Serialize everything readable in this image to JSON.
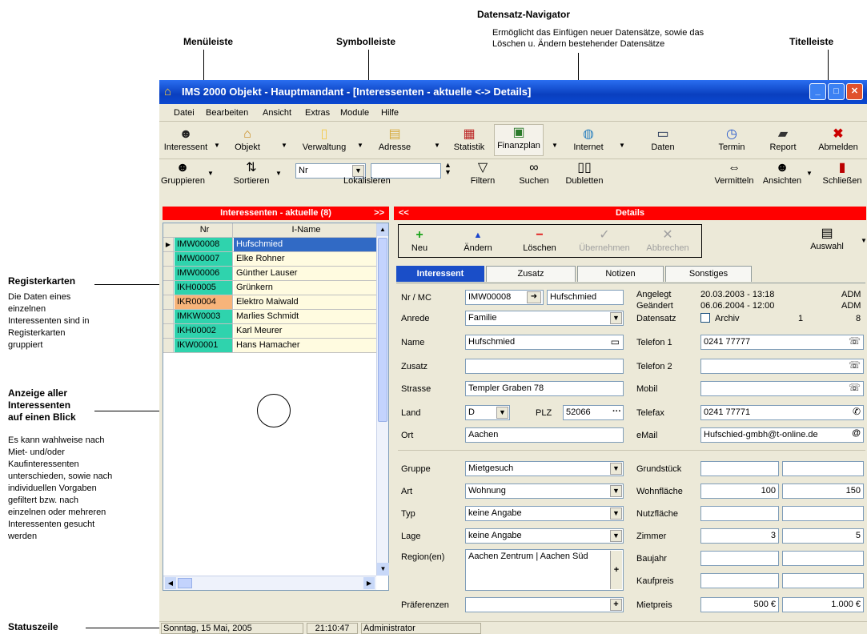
{
  "annotations": {
    "datensatz_title": "Datensatz-Navigator",
    "datensatz_desc1": "Ermöglicht das Einfügen neuer Datensätze, sowie das",
    "datensatz_desc2": "Löschen u. Ändern bestehender Datensätze",
    "menueleiste": "Menüleiste",
    "symbolleiste": "Symbolleiste",
    "titelleiste": "Titelleiste",
    "registerkarten_title": "Registerkarten",
    "registerkarten_desc": [
      "Die Daten eines",
      "einzelnen",
      "Interessenten sind in",
      "Registerkarten",
      "gruppiert"
    ],
    "anzeige_title": [
      "Anzeige aller",
      "Interessenten",
      "auf einen Blick"
    ],
    "anzeige_desc": [
      "Es kann wahlweise nach",
      "Miet- und/oder",
      "Kaufinteressenten",
      "unterschieden, sowie nach",
      "individuellen Vorgaben",
      "gefiltert bzw. nach",
      "einzelnen oder mehreren",
      "Interessenten gesucht",
      "werden"
    ],
    "statuszeile": "Statuszeile"
  },
  "window": {
    "title": "IMS 2000 Objekt - Hauptmandant - [Interessenten - aktuelle <-> Details]",
    "menu": [
      "Datei",
      "Bearbeiten",
      "Ansicht",
      "Extras",
      "Module",
      "Hilfe"
    ],
    "toolbar1": [
      {
        "label": "Interessent",
        "icon": "person-icon"
      },
      {
        "label": "Objekt",
        "icon": "house-icon"
      },
      {
        "label": "Verwaltung",
        "icon": "document-icon"
      },
      {
        "label": "Adresse",
        "icon": "folder-icon"
      },
      {
        "label": "Statistik",
        "icon": "chart-icon"
      },
      {
        "label": "Finanzplan",
        "icon": "finance-icon"
      },
      {
        "label": "Internet",
        "icon": "globe-icon"
      },
      {
        "label": "Daten",
        "icon": "computer-icon"
      },
      {
        "label": "Termin",
        "icon": "clock-icon"
      },
      {
        "label": "Report",
        "icon": "printer-icon"
      },
      {
        "label": "Abmelden",
        "icon": "close-x-icon"
      }
    ],
    "toolbar2": {
      "gruppieren": "Gruppieren",
      "sortieren": "Sortieren",
      "sort_field": "Nr",
      "lokalisieren": "Lokalisieren",
      "filtern": "Filtern",
      "suchen": "Suchen",
      "dubletten": "Dubletten",
      "vermitteln": "Vermitteln",
      "ansichten": "Ansichten",
      "schliessen": "Schließen"
    },
    "list_header": "Interessenten - aktuelle (8)",
    "list_header_arrow": ">>",
    "details_header": "Details",
    "details_header_arrow": "<<",
    "grid_cols": [
      "Nr",
      "I-Name"
    ],
    "grid_rows": [
      {
        "nr": "IMW00008",
        "name": "Hufschmied",
        "color": "#2fd3ad",
        "selected": true
      },
      {
        "nr": "IMW00007",
        "name": "Elke Rohner",
        "color": "#2fd3ad"
      },
      {
        "nr": "IMW00006",
        "name": "Günther Lauser",
        "color": "#2fd3ad"
      },
      {
        "nr": "IKH00005",
        "name": "Grünkern",
        "color": "#2fd3ad"
      },
      {
        "nr": "IKR00004",
        "name": "Elektro Maiwald",
        "color": "#f7b47a"
      },
      {
        "nr": "IMKW0003",
        "name": "Marlies Schmidt",
        "color": "#2fd3ad"
      },
      {
        "nr": "IKH00002",
        "name": "Karl Meurer",
        "color": "#2fd3ad"
      },
      {
        "nr": "IKW00001",
        "name": "Hans Hamacher",
        "color": "#2fd3ad"
      }
    ],
    "nav_buttons": [
      "Neu",
      "Ändern",
      "Löschen",
      "Übernehmen",
      "Abbrechen"
    ],
    "auswahl": "Auswahl",
    "tabs": [
      "Interessent",
      "Zusatz",
      "Notizen",
      "Sonstiges"
    ],
    "form": {
      "nr_mc_label": "Nr / MC",
      "nr": "IMW00008",
      "mc": "Hufschmied",
      "anrede_label": "Anrede",
      "anrede": "Familie",
      "name_label": "Name",
      "name": "Hufschmied",
      "zusatz_label": "Zusatz",
      "zusatz": "",
      "strasse_label": "Strasse",
      "strasse": "Templer Graben 78",
      "land_label": "Land",
      "land": "D",
      "plz_label": "PLZ",
      "plz": "52066",
      "ort_label": "Ort",
      "ort": "Aachen",
      "angelegt_label": "Angelegt",
      "angelegt": "20.03.2003 - 13:18",
      "angelegt_user": "ADM",
      "geaendert_label": "Geändert",
      "geaendert": "06.06.2004 - 12:00",
      "geaendert_user": "ADM",
      "datensatz_label": "Datensatz",
      "archiv_label": "Archiv",
      "datensatz_nr": "1",
      "datensatz_total": "8",
      "telefon1_label": "Telefon 1",
      "telefon1": "0241 77777",
      "telefon2_label": "Telefon 2",
      "telefon2": "",
      "mobil_label": "Mobil",
      "mobil": "",
      "telefax_label": "Telefax",
      "telefax": "0241 77771",
      "email_label": "eMail",
      "email": "Hufschied-gmbh@t-online.de",
      "gruppe_label": "Gruppe",
      "gruppe": "Mietgesuch",
      "art_label": "Art",
      "art": "Wohnung",
      "typ_label": "Typ",
      "typ": "keine Angabe",
      "lage_label": "Lage",
      "lage": "keine Angabe",
      "region_label": "Region(en)",
      "region": "Aachen Zentrum | Aachen Süd",
      "praeferenzen_label": "Präferenzen",
      "praeferenzen": "",
      "grundstueck_label": "Grundstück",
      "wohnflaeche_label": "Wohnfläche",
      "wohnflaeche_min": "100",
      "wohnflaeche_max": "150",
      "nutzflaeche_label": "Nutzfläche",
      "zimmer_label": "Zimmer",
      "zimmer_min": "3",
      "zimmer_max": "5",
      "baujahr_label": "Baujahr",
      "kaufpreis_label": "Kaufpreis",
      "mietpreis_label": "Mietpreis",
      "mietpreis_min": "500 €",
      "mietpreis_max": "1.000 €"
    },
    "status": {
      "date": "Sonntag, 15 Mai, 2005",
      "time": "21:10:47",
      "user": "Administrator"
    }
  },
  "colors": {
    "title_blue": "#0a3fbf",
    "header_red": "#ff0000",
    "selection": "#316ac5"
  }
}
